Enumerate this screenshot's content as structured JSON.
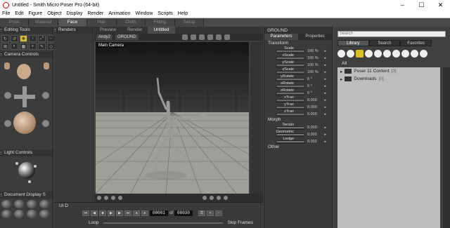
{
  "window": {
    "title": "Untitled - Smith Micro Poser Pro  (64-bit)"
  },
  "menu": [
    "File",
    "Edit",
    "Figure",
    "Object",
    "Display",
    "Render",
    "Animation",
    "Window",
    "Scripts",
    "Help"
  ],
  "room_tabs": [
    "Pose",
    "Material",
    "Face",
    "Hair",
    "Cloth",
    "Fitting",
    "Setup"
  ],
  "room_active": "Face",
  "editing_tools": {
    "label": "Editing Tools"
  },
  "camera_controls": {
    "label": "Camera Controls"
  },
  "light_controls": {
    "label": "Light Controls"
  },
  "document_display": {
    "label": "Document Display S"
  },
  "renders": {
    "label": "Renders"
  },
  "ui_dots": {
    "label": "UI D"
  },
  "viewport": {
    "tabs": [
      "Preview",
      "Render",
      "Untitled"
    ],
    "active_tab": "Untitled",
    "figure_select": "Andy2",
    "element_select": "GROUND",
    "camera_label": "Main Camera"
  },
  "animation": {
    "current_frame": "00001",
    "of_label": "of",
    "total_frames": "00030",
    "loop_label": "Loop",
    "skip_frames_label": "Skip Frames"
  },
  "parameters": {
    "actor": "GROUND",
    "tabs": [
      "Parameters",
      "Properties"
    ],
    "transform_label": "Transform",
    "transform": [
      {
        "name": "Scale",
        "value": "100 %"
      },
      {
        "name": "xScale",
        "value": "100 %"
      },
      {
        "name": "yScale",
        "value": "100 %"
      },
      {
        "name": "zScale",
        "value": "100 %"
      },
      {
        "name": "yRotate",
        "value": "0 °"
      },
      {
        "name": "xRotate",
        "value": "0 °"
      },
      {
        "name": "zRotate",
        "value": "0 °"
      },
      {
        "name": "xTran",
        "value": "0.000"
      },
      {
        "name": "yTran",
        "value": "0.000"
      },
      {
        "name": "zTran",
        "value": "0.000"
      }
    ],
    "morph_label": "Morph",
    "morph": [
      {
        "name": "Terrain",
        "value": "0.000"
      },
      {
        "name": "Geometric",
        "value": "0.000"
      },
      {
        "name": "Ledge",
        "value": "0.000"
      }
    ],
    "other_label": "Other"
  },
  "library": {
    "search_placeholder": "Search",
    "tabs": [
      "Library",
      "Search",
      "Favorites"
    ],
    "active_tab": "Library",
    "all_label": "All",
    "items": [
      {
        "name": "Poser 11 Content",
        "count": "[3]"
      },
      {
        "name": "Downloads",
        "count": "[0]"
      }
    ]
  }
}
